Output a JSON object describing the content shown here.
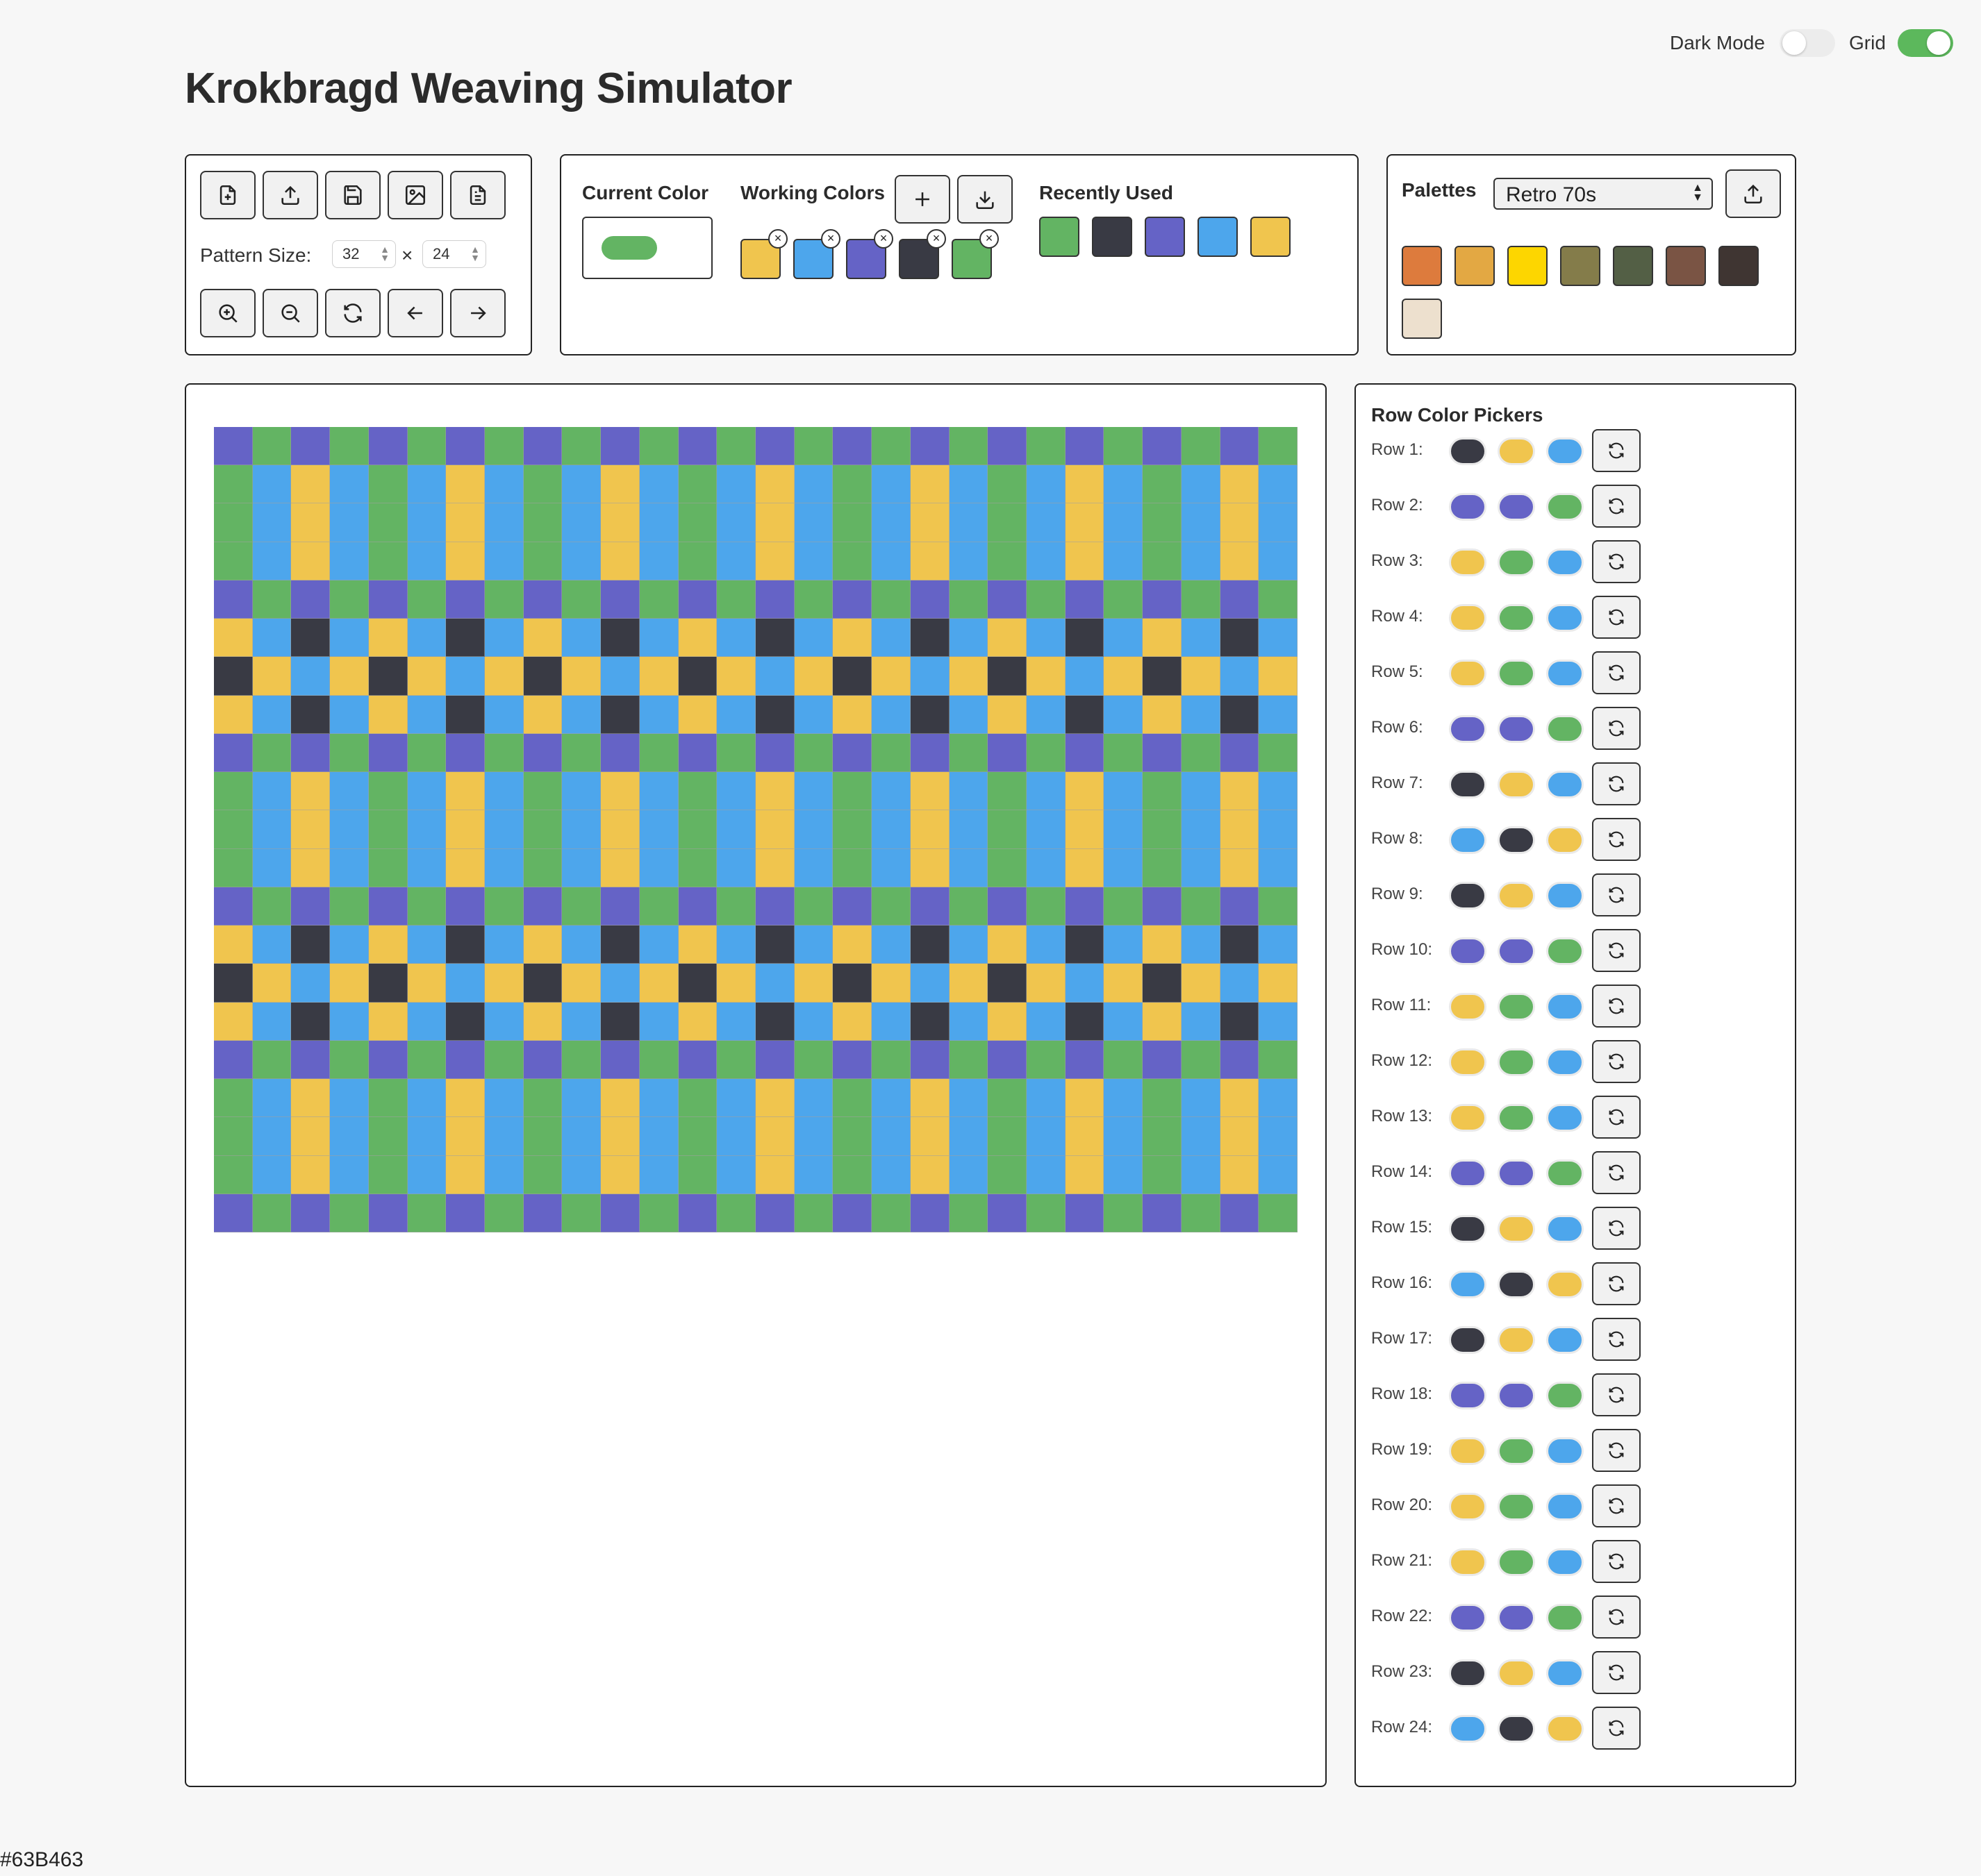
{
  "app": {
    "title": "Krokbragd Weaving Simulator"
  },
  "toggles": {
    "dark_mode_label": "Dark Mode",
    "grid_label": "Grid"
  },
  "toolbar": {
    "pattern_size_label": "Pattern Size:",
    "width": "32",
    "height": "24",
    "times": "×",
    "file_buttons": [
      "new-file-icon",
      "upload-icon",
      "save-icon",
      "image-icon",
      "document-icon"
    ],
    "view_buttons": [
      "zoom-in-icon",
      "zoom-out-icon",
      "refresh-icon",
      "arrow-left-icon",
      "arrow-right-icon"
    ]
  },
  "colors": {
    "current_color_label": "Current Color",
    "current_color": "#63B463",
    "working_colors_label": "Working Colors",
    "working_colors": [
      "#F0C54E",
      "#4DA6EC",
      "#6563C6",
      "#393A44",
      "#63B463"
    ],
    "recently_used_label": "Recently Used",
    "recently_used": [
      "#63B463",
      "#393A44",
      "#6563C6",
      "#4DA6EC",
      "#F0C54E"
    ],
    "remove_glyph": "×"
  },
  "palettes": {
    "label": "Palettes",
    "selected": "Retro 70s",
    "swatches": [
      "#DD7B3D",
      "#E3A843",
      "#FDD600",
      "#847C4A",
      "#535F45",
      "#7A5444",
      "#3F3532",
      "#EDE0CE"
    ]
  },
  "row_pickers": {
    "title": "Row Color Pickers",
    "rows": [
      {
        "label": "Row 1:",
        "colors": [
          "#393A44",
          "#F0C54E",
          "#4DA6EC"
        ]
      },
      {
        "label": "Row 2:",
        "colors": [
          "#6563C6",
          "#6563C6",
          "#63B463"
        ]
      },
      {
        "label": "Row 3:",
        "colors": [
          "#F0C54E",
          "#63B463",
          "#4DA6EC"
        ]
      },
      {
        "label": "Row 4:",
        "colors": [
          "#F0C54E",
          "#63B463",
          "#4DA6EC"
        ]
      },
      {
        "label": "Row 5:",
        "colors": [
          "#F0C54E",
          "#63B463",
          "#4DA6EC"
        ]
      },
      {
        "label": "Row 6:",
        "colors": [
          "#6563C6",
          "#6563C6",
          "#63B463"
        ]
      },
      {
        "label": "Row 7:",
        "colors": [
          "#393A44",
          "#F0C54E",
          "#4DA6EC"
        ]
      },
      {
        "label": "Row 8:",
        "colors": [
          "#4DA6EC",
          "#393A44",
          "#F0C54E"
        ]
      },
      {
        "label": "Row 9:",
        "colors": [
          "#393A44",
          "#F0C54E",
          "#4DA6EC"
        ]
      },
      {
        "label": "Row 10:",
        "colors": [
          "#6563C6",
          "#6563C6",
          "#63B463"
        ]
      },
      {
        "label": "Row 11:",
        "colors": [
          "#F0C54E",
          "#63B463",
          "#4DA6EC"
        ]
      },
      {
        "label": "Row 12:",
        "colors": [
          "#F0C54E",
          "#63B463",
          "#4DA6EC"
        ]
      },
      {
        "label": "Row 13:",
        "colors": [
          "#F0C54E",
          "#63B463",
          "#4DA6EC"
        ]
      },
      {
        "label": "Row 14:",
        "colors": [
          "#6563C6",
          "#6563C6",
          "#63B463"
        ]
      },
      {
        "label": "Row 15:",
        "colors": [
          "#393A44",
          "#F0C54E",
          "#4DA6EC"
        ]
      },
      {
        "label": "Row 16:",
        "colors": [
          "#4DA6EC",
          "#393A44",
          "#F0C54E"
        ]
      },
      {
        "label": "Row 17:",
        "colors": [
          "#393A44",
          "#F0C54E",
          "#4DA6EC"
        ]
      },
      {
        "label": "Row 18:",
        "colors": [
          "#6563C6",
          "#6563C6",
          "#63B463"
        ]
      },
      {
        "label": "Row 19:",
        "colors": [
          "#F0C54E",
          "#63B463",
          "#4DA6EC"
        ]
      },
      {
        "label": "Row 20:",
        "colors": [
          "#F0C54E",
          "#63B463",
          "#4DA6EC"
        ]
      },
      {
        "label": "Row 21:",
        "colors": [
          "#F0C54E",
          "#63B463",
          "#4DA6EC"
        ]
      },
      {
        "label": "Row 22:",
        "colors": [
          "#6563C6",
          "#6563C6",
          "#63B463"
        ]
      },
      {
        "label": "Row 23:",
        "colors": [
          "#393A44",
          "#F0C54E",
          "#4DA6EC"
        ]
      },
      {
        "label": "Row 24:",
        "colors": [
          "#4DA6EC",
          "#393A44",
          "#F0C54E"
        ]
      }
    ]
  },
  "weave_pattern": {
    "colors": {
      "G": "#63B463",
      "B": "#4DA6EC",
      "Y": "#F0C54E",
      "P": "#6563C6",
      "D": "#393A44"
    },
    "row_cycle": [
      "GBYBGBYBGBYBGBYBGBYBGBYBGBYB",
      "GBYBGBYBGBYBGBYBGBYBGBYBGBYB",
      "GBYBGBYBGBYBGBYBGBYBGBYBGBYB",
      "PGPGPGPGPGPGPGPGPGPGPGPGPGPG",
      "YBDBYBDBYBDBYBDBYBDBYBDBYBDB",
      "DYBYDYBYDYBYDYBYDYBYDYBYDYBY",
      "YBDBYBDBYBDBYBDBYBDBYBDBYBDB",
      "PGPGPGPGPGPGPGPGPGPGPGPGPGPG"
    ],
    "row_order": [
      7,
      0,
      1,
      2,
      3,
      4,
      5,
      6,
      7,
      0,
      1,
      2,
      3,
      4,
      5,
      6,
      7,
      0,
      1,
      2,
      3
    ]
  },
  "footer": {
    "hex": "#63B463"
  }
}
